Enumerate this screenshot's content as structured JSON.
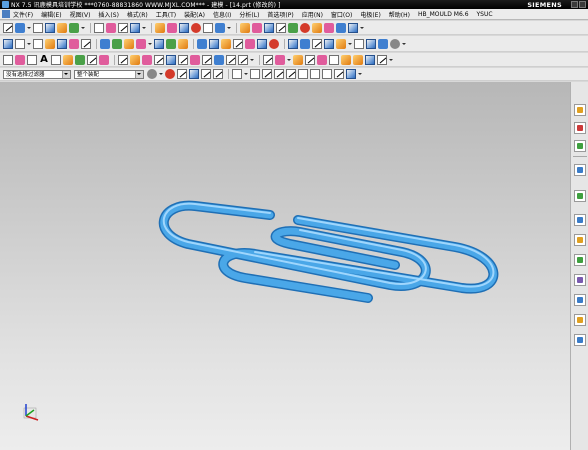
{
  "window": {
    "title": "NX 7.5 讯鹿模具培训学校 ***0760-88831860 WWW.MJXL.COM*** - 建模 - [14.prt (修改的) ]",
    "brand": "SIEMENS"
  },
  "menu": {
    "items": [
      {
        "label": "文件(F)"
      },
      {
        "label": "编辑(E)"
      },
      {
        "label": "视图(V)"
      },
      {
        "label": "插入(S)"
      },
      {
        "label": "格式(R)"
      },
      {
        "label": "工具(T)"
      },
      {
        "label": "装配(A)"
      },
      {
        "label": "信息(I)"
      },
      {
        "label": "分析(L)"
      },
      {
        "label": "首选项(P)"
      },
      {
        "label": "应用(N)"
      },
      {
        "label": "窗口(O)"
      },
      {
        "label": "电极(E)"
      },
      {
        "label": "帮助(H)"
      },
      {
        "label": "HB_MOULD M6.6"
      },
      {
        "label": "YSUC"
      }
    ]
  },
  "selection_bar": {
    "type_filter": "没有选择过滤器",
    "scope": "整个装配"
  },
  "viewport": {
    "background_top": "#b7b7b7",
    "background_bottom": "#ededed",
    "part_color": "#4aa7e8",
    "part_highlight": "#a8dcff",
    "part_shadow": "#1f6fb5",
    "axis_colors": {
      "x": "#cc2020",
      "y": "#20a020",
      "z": "#2040d0"
    }
  },
  "icons": {
    "toolbar_row_1": [
      "view-fit-icon",
      "pan-icon",
      "rotate-icon",
      "zoom-icon",
      "shaded-edges-icon",
      "wireframe-icon",
      "layer-icon",
      "sketch-icon",
      "extrude-icon",
      "revolve-icon",
      "hole-icon",
      "blend-icon",
      "chamfer-icon",
      "shell-icon",
      "mirror-icon",
      "unite-icon",
      "subtract-icon"
    ],
    "right_resource_bar": [
      "assembly-navigator-icon",
      "constraint-navigator-icon",
      "part-navigator-icon",
      "reuse-library-icon",
      "web-browser-icon",
      "history-icon",
      "system-materials-icon",
      "process-studio-icon",
      "manufacturing-wizard-icon",
      "roles-icon",
      "system-scenes-icon"
    ]
  }
}
